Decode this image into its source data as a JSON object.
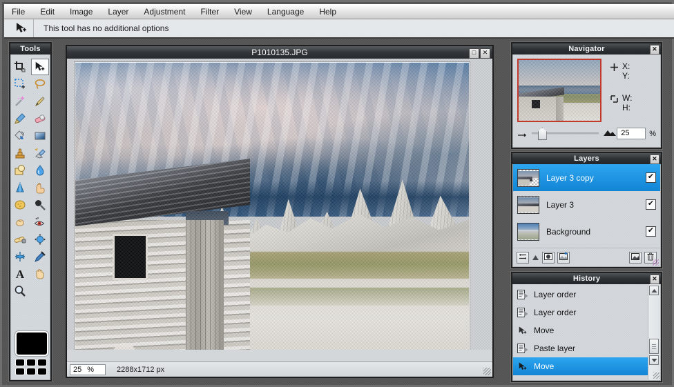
{
  "app": {
    "menu": [
      {
        "label": "File"
      },
      {
        "label": "Edit"
      },
      {
        "label": "Image"
      },
      {
        "label": "Layer"
      },
      {
        "label": "Adjustment"
      },
      {
        "label": "Filter"
      },
      {
        "label": "View"
      },
      {
        "label": "Language"
      },
      {
        "label": "Help"
      }
    ],
    "options_bar": {
      "tool_icon": "move-tool-icon",
      "message": "This tool has no additional options"
    },
    "accent_color": "#1285d6",
    "selection_color": "#2ea6ef",
    "nav_frame_color": "#c0392b"
  },
  "tools_panel": {
    "title": "Tools",
    "tools": [
      {
        "name": "crop-tool",
        "icon": "crop-icon",
        "selected": false
      },
      {
        "name": "move-tool",
        "icon": "move-icon",
        "selected": true
      },
      {
        "name": "marquee-select-tool",
        "icon": "marquee-icon",
        "selected": false
      },
      {
        "name": "lasso-select-tool",
        "icon": "lasso-icon",
        "selected": false
      },
      {
        "name": "magic-wand-tool",
        "icon": "wand-icon",
        "selected": false
      },
      {
        "name": "pencil-tool",
        "icon": "pencil-icon",
        "selected": false
      },
      {
        "name": "brush-tool",
        "icon": "brush-icon",
        "selected": false
      },
      {
        "name": "eraser-tool",
        "icon": "eraser-icon",
        "selected": false
      },
      {
        "name": "paint-bucket-tool",
        "icon": "bucket-icon",
        "selected": false
      },
      {
        "name": "gradient-tool",
        "icon": "gradient-icon",
        "selected": false
      },
      {
        "name": "clone-stamp-tool",
        "icon": "stamp-icon",
        "selected": false
      },
      {
        "name": "color-replace-tool",
        "icon": "color-replace-icon",
        "selected": false
      },
      {
        "name": "drawing-tool",
        "icon": "shape-icon",
        "selected": false
      },
      {
        "name": "blur-tool",
        "icon": "water-drop-icon",
        "selected": false
      },
      {
        "name": "sharpen-tool",
        "icon": "cone-icon",
        "selected": false
      },
      {
        "name": "smudge-tool",
        "icon": "finger-icon",
        "selected": false
      },
      {
        "name": "sponge-tool",
        "icon": "sponge-icon",
        "selected": false
      },
      {
        "name": "dodge-tool",
        "icon": "dodge-icon",
        "selected": false
      },
      {
        "name": "burn-tool",
        "icon": "burn-icon",
        "selected": false
      },
      {
        "name": "red-eye-tool",
        "icon": "red-eye-icon",
        "selected": false
      },
      {
        "name": "spot-heal-tool",
        "icon": "bandage-icon",
        "selected": false
      },
      {
        "name": "bloat-tool",
        "icon": "bloat-icon",
        "selected": false
      },
      {
        "name": "pinch-tool",
        "icon": "pinch-icon",
        "selected": false
      },
      {
        "name": "eyedropper-tool",
        "icon": "eyedropper-icon",
        "selected": false
      },
      {
        "name": "type-tool",
        "icon": "text-a-icon",
        "selected": false
      },
      {
        "name": "hand-tool",
        "icon": "hand-icon",
        "selected": false
      },
      {
        "name": "zoom-tool",
        "icon": "magnifier-icon",
        "selected": false
      }
    ],
    "primary_color": "#000000",
    "palette": [
      "#000000",
      "#000000",
      "#000000",
      "#000000",
      "#000000",
      "#000000"
    ]
  },
  "document": {
    "title": "P1010135.JPG",
    "restore_label": "□",
    "close_label": "✕",
    "status": {
      "zoom_value": "25",
      "zoom_unit": "%",
      "dimensions": "2288x1712 px"
    }
  },
  "navigator": {
    "title": "Navigator",
    "close_label": "✕",
    "coords": [
      {
        "icon": "crosshair-icon",
        "labels": [
          "X:",
          "Y:"
        ],
        "values": [
          "",
          ""
        ]
      },
      {
        "icon": "bounds-icon",
        "labels": [
          "W:",
          "H:"
        ],
        "values": [
          "",
          ""
        ]
      }
    ],
    "zoom_out_icon": "small-mountain-icon",
    "zoom_in_icon": "large-mountain-icon",
    "zoom_value": "25",
    "zoom_unit": "%",
    "slider_position_pct": 9
  },
  "layers": {
    "title": "Layers",
    "close_label": "✕",
    "items": [
      {
        "label": "Layer 3 copy",
        "visible": true,
        "selected": true,
        "thumb": "transparent-partial"
      },
      {
        "label": "Layer 3",
        "visible": true,
        "selected": false,
        "thumb": "transparent-partial"
      },
      {
        "label": "Background",
        "visible": true,
        "selected": false,
        "thumb": "full-photo"
      }
    ],
    "check_glyph": "✔",
    "toolbar": [
      {
        "name": "layer-settings-button",
        "icon": "sliders-icon"
      },
      {
        "name": "move-layer-up-button",
        "icon": "caret-up-icon"
      },
      {
        "name": "layer-mask-button",
        "icon": "mask-circle-icon"
      },
      {
        "name": "new-layer-button",
        "icon": "new-layer-icon"
      },
      {
        "name": "merge-layer-down-button",
        "icon": "merge-down-icon"
      },
      {
        "name": "delete-layer-button",
        "icon": "trash-icon"
      }
    ]
  },
  "history": {
    "title": "History",
    "close_label": "✕",
    "items": [
      {
        "label": "Layer order",
        "icon": "layer-order-icon",
        "selected": false
      },
      {
        "label": "Layer order",
        "icon": "layer-order-icon",
        "selected": false
      },
      {
        "label": "Move",
        "icon": "move-icon",
        "selected": false
      },
      {
        "label": "Paste layer",
        "icon": "layer-order-icon",
        "selected": false
      },
      {
        "label": "Move",
        "icon": "move-icon",
        "selected": true
      }
    ],
    "scroll_up_glyph": "▴",
    "scroll_down_glyph": "▾"
  }
}
